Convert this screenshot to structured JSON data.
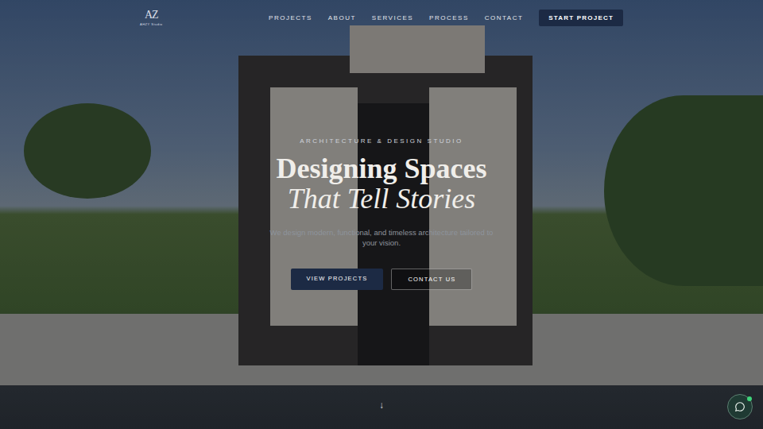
{
  "logo": {
    "mark": "AZ",
    "name": "AHZY Studio"
  },
  "nav": {
    "links": [
      "PROJECTS",
      "ABOUT",
      "SERVICES",
      "PROCESS",
      "CONTACT"
    ],
    "cta": "START PROJECT"
  },
  "hero": {
    "eyebrow": "ARCHITECTURE & DESIGN STUDIO",
    "title_line1": "Designing Spaces",
    "title_line2": "That Tell Stories",
    "subtitle": "We design modern, functional, and timeless architecture tailored to your vision.",
    "buttons": [
      {
        "label": "VIEW PROJECTS",
        "kind": "primary"
      },
      {
        "label": "CONTACT US",
        "kind": "outline"
      }
    ],
    "scroll": "↓"
  },
  "chat": {
    "online": true
  }
}
